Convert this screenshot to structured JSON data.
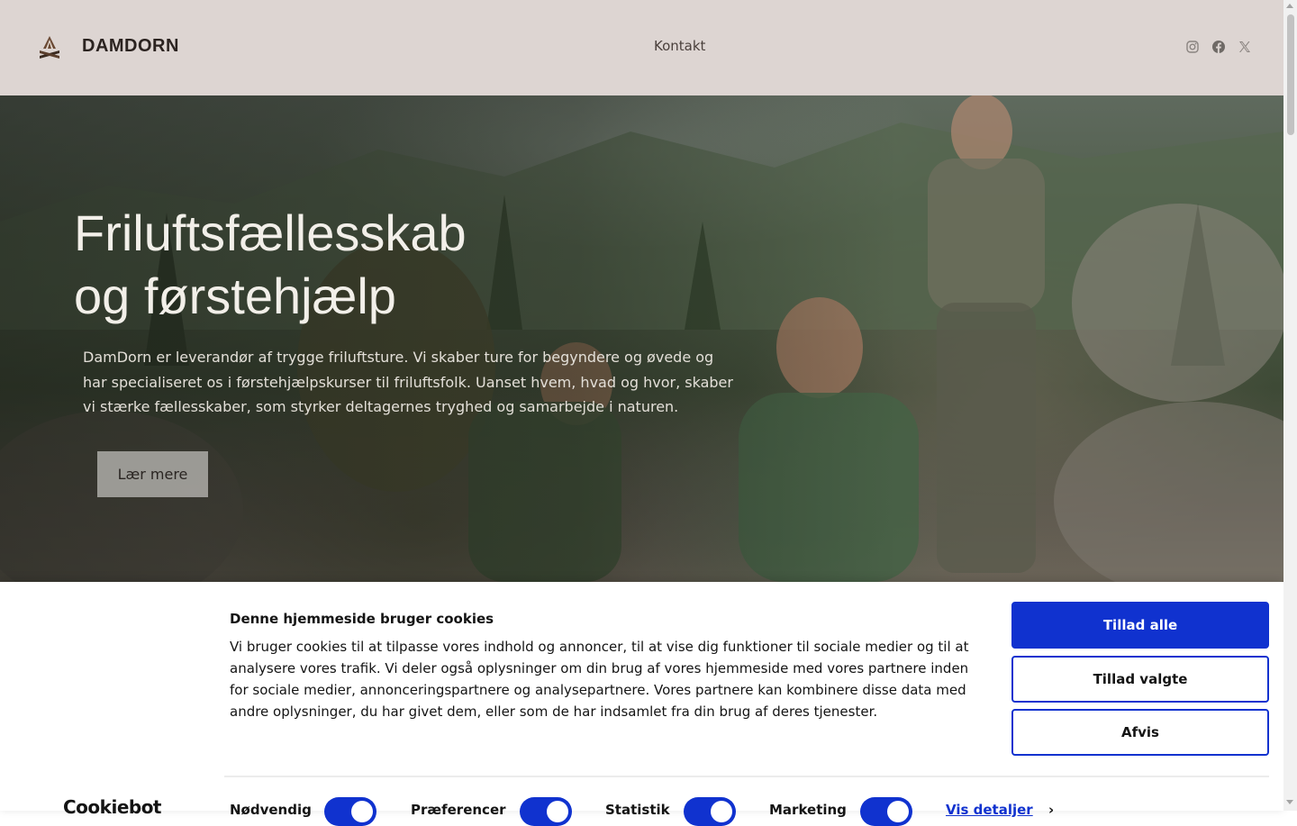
{
  "header": {
    "brand": "DAMDORN",
    "logo_icon": "campfire-tent-icon",
    "nav": [
      {
        "label": "Kontakt"
      }
    ],
    "social": [
      {
        "icon": "instagram-icon"
      },
      {
        "icon": "facebook-icon"
      },
      {
        "icon": "x-twitter-icon"
      }
    ]
  },
  "hero": {
    "title_line1": "Friluftsfællesskab",
    "title_line2": "og førstehjælp",
    "text": "DamDorn er leverandør af trygge friluftsture. Vi skaber ture for begyndere og øvede og har specialiseret os i førstehjælpskurser til friluftsfolk. Uanset hvem, hvad og hvor, skaber vi stærke fællesskaber, som styrker deltagernes tryghed og samarbejde i naturen.",
    "button_label": "Lær mere"
  },
  "cookie_banner": {
    "title": "Denne hjemmeside bruger cookies",
    "text": "Vi bruger cookies til at tilpasse vores indhold og annoncer, til at vise dig funktioner til sociale medier og til at analysere vores trafik. Vi deler også oplysninger om din brug af vores hjemmeside med vores partnere inden for sociale medier, annonceringspartnere og analysepartnere. Vores partnere kan kombinere disse data med andre oplysninger, du har givet dem, eller som de har indsamlet fra din brug af deres tjenester.",
    "buttons": {
      "allow_all": "Tillad alle",
      "allow_selected": "Tillad valgte",
      "deny": "Afvis"
    },
    "brand": "Cookiebot",
    "toggles": [
      {
        "label": "Nødvendig",
        "checked": true
      },
      {
        "label": "Præferencer",
        "checked": true
      },
      {
        "label": "Statistik",
        "checked": true
      },
      {
        "label": "Marketing",
        "checked": true
      }
    ],
    "details_link": "Vis detaljer",
    "details_chevron": "›"
  },
  "colors": {
    "header_bg": "#ddd5d2",
    "accent_blue": "#1032cf"
  }
}
